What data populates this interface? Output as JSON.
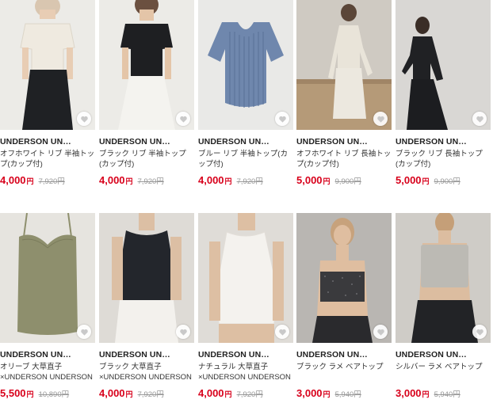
{
  "colors": {
    "price": "#d8001b",
    "original_price": "#999999"
  },
  "heart_icon": "heart-icon",
  "products": [
    {
      "brand": "UNDERSON UN…",
      "name": "オフホワイト リブ 半袖トップ(カップ付)",
      "price": "4,000",
      "yen": "円",
      "original": "7,920円",
      "img_bg": "#ecebe7",
      "garment": "#efeae0"
    },
    {
      "brand": "UNDERSON UN…",
      "name": "ブラック リブ 半袖トップ(カップ付)",
      "price": "4,000",
      "yen": "円",
      "original": "7,920円",
      "img_bg": "#ecebe7",
      "garment": "#1e1f22"
    },
    {
      "brand": "UNDERSON UN…",
      "name": "ブルー リブ 半袖トップ(カップ付)",
      "price": "4,000",
      "yen": "円",
      "original": "7,920円",
      "img_bg": "#e9e9e7",
      "garment": "#6f87ad"
    },
    {
      "brand": "UNDERSON UN…",
      "name": "オフホワイト リブ 長袖トップ(カップ付)",
      "price": "5,000",
      "yen": "円",
      "original": "9,900円",
      "img_bg": "#cfcac2",
      "garment": "#e9e4d9"
    },
    {
      "brand": "UNDERSON UN…",
      "name": "ブラック リブ 長袖トップ(カップ付)",
      "price": "5,000",
      "yen": "円",
      "original": "9,900円",
      "img_bg": "#d9d7d4",
      "garment": "#202124"
    },
    {
      "brand": "UNDERSON UN…",
      "name": "オリーブ 大草直子×UNDERSON UNDERSON カッ…",
      "price": "5,500",
      "yen": "円",
      "original": "10,890円",
      "img_bg": "#e6e4df",
      "garment": "#8e8f6d"
    },
    {
      "brand": "UNDERSON UN…",
      "name": "ブラック 大草直子×UNDERSON UNDERSON アメ…",
      "price": "4,000",
      "yen": "円",
      "original": "7,920円",
      "img_bg": "#dedbd6",
      "garment": "#23262c"
    },
    {
      "brand": "UNDERSON UN…",
      "name": "ナチュラル 大草直子×UNDERSON UNDERSON …",
      "price": "4,000",
      "yen": "円",
      "original": "7,920円",
      "img_bg": "#dfdcd7",
      "garment": "#f4f2ee"
    },
    {
      "brand": "UNDERSON UN…",
      "name": "ブラック ラメ ベアトップ",
      "price": "3,000",
      "yen": "円",
      "original": "5,940円",
      "img_bg": "#b9b6b2",
      "garment": "#3a3a3d"
    },
    {
      "brand": "UNDERSON UN…",
      "name": "シルバー ラメ ベアトップ",
      "price": "3,000",
      "yen": "円",
      "original": "5,940円",
      "img_bg": "#cfccc7",
      "garment": "#bcbab4"
    }
  ]
}
